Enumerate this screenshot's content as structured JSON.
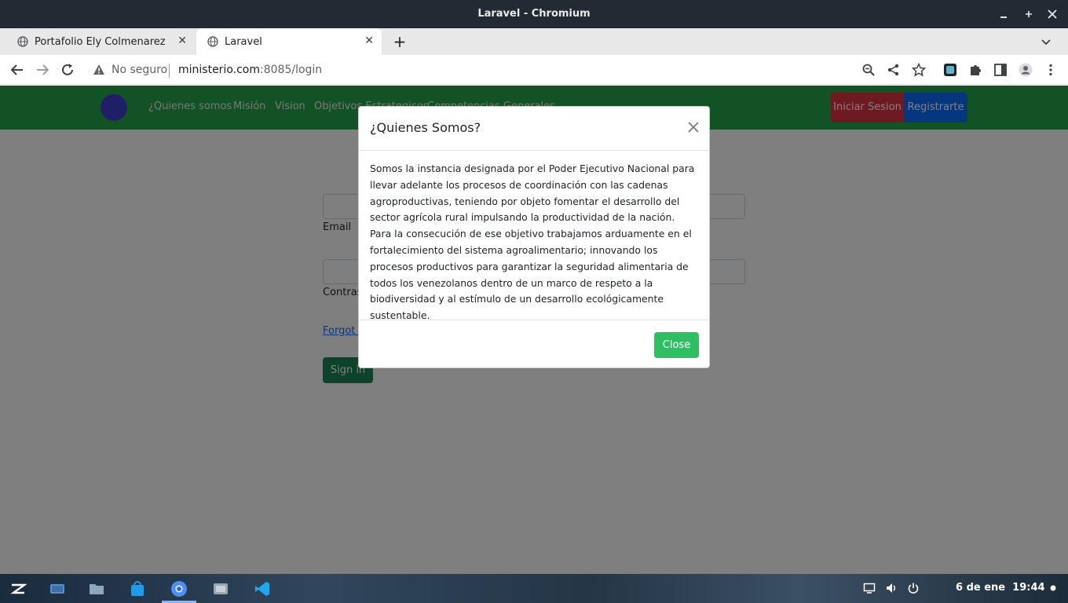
{
  "window": {
    "title": "Laravel - Chromium"
  },
  "tabs": [
    {
      "label": "Portafolio Ely Colmenarez",
      "active": false
    },
    {
      "label": "Laravel",
      "active": true
    }
  ],
  "address_bar": {
    "security_label": "No seguro",
    "url_host": "ministerio.com",
    "url_rest": ":8085/login"
  },
  "site": {
    "nav_links": [
      "¿Quienes somos",
      "Misión",
      "Vision",
      "Objetivos Estrategicos",
      "Competencias Generales"
    ],
    "login_button": "Iniciar Sesion",
    "register_button": "Registrarte",
    "email_label": "Email",
    "password_label": "Contraseña",
    "forgot_link": "Forgot your password?",
    "signin_button": "Sign in"
  },
  "modal": {
    "title": "¿Quienes Somos?",
    "body": "Somos la instancia designada por el Poder Ejecutivo Nacional para llevar adelante los procesos de coordinación con las cadenas agroproductivas, teniendo por objeto fomentar el desarrollo del sector agrícola rural impulsando la productividad de la nación. Para la consecución de ese objetivo trabajamos arduamente en el fortalecimiento del sistema agroalimentario; innovando los procesos productivos para garantizar la seguridad alimentaria de todos los venezolanos dentro de un marco de respeto a la biodiversidad y al estímulo de un desarrollo ecológicamente sustentable.",
    "close_button": "Close"
  },
  "taskbar": {
    "date": "6 de ene",
    "time": "19:44"
  },
  "colors": {
    "navbar": "#26a54b",
    "login": "#dc3545",
    "register": "#0d6efd",
    "close_button": "#2ebf62"
  }
}
